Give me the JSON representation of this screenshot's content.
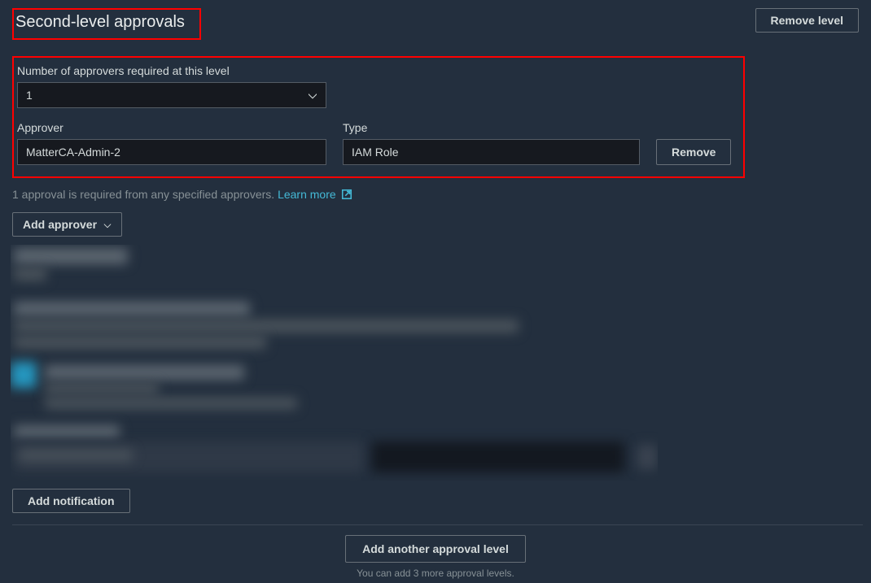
{
  "header": {
    "title": "Second-level approvals",
    "remove_level_label": "Remove level"
  },
  "fields": {
    "num_approvers_label": "Number of approvers required at this level",
    "num_approvers_value": "1",
    "approver_label": "Approver",
    "approver_value": "MatterCA-Admin-2",
    "type_label": "Type",
    "type_value": "IAM Role",
    "remove_label": "Remove"
  },
  "helper": {
    "text": "1 approval is required from any specified approvers.",
    "learn_more": "Learn more"
  },
  "actions": {
    "add_approver_label": "Add approver",
    "add_notification_label": "Add notification"
  },
  "footer": {
    "add_another_label": "Add another approval level",
    "help_text": "You can add 3 more approval levels."
  }
}
